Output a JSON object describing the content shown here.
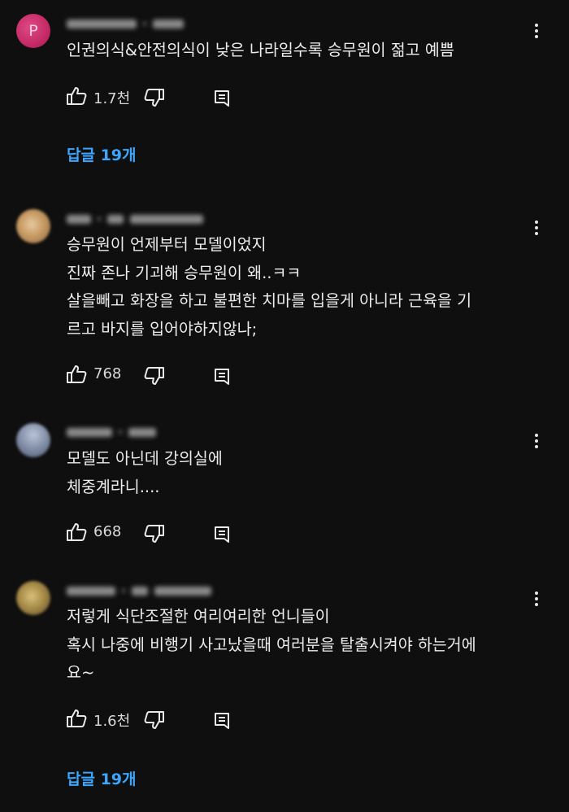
{
  "comments": [
    {
      "avatar_letter": "P",
      "lines": [
        "인권의식&안전의식이 낮은 나라일수록 승무원이 젊고 예쁨"
      ],
      "likes": "1.7천",
      "replies_label": "답글 19개"
    },
    {
      "lines": [
        "승무원이 언제부터 모델이었지",
        "진짜 존나 기괴해 승무원이 왜..ㅋㅋ",
        "살을빼고 화장을 하고 불편한 치마를 입을게 아니라 근육을 기",
        "르고 바지를 입어야하지않나;"
      ],
      "likes": "768"
    },
    {
      "lines": [
        "모델도 아닌데 강의실에",
        "체중계라니...."
      ],
      "likes": "668"
    },
    {
      "lines": [
        "저렇게 식단조절한 여리여리한 언니들이",
        "혹시 나중에 비행기 사고났을때 여러분을 탈출시켜야 하는거에",
        "요~"
      ],
      "likes": "1.6천",
      "replies_label": "답글 19개"
    }
  ],
  "colors": {
    "background": "#0f0f0f",
    "text": "#f1f1f1",
    "reply_link": "#3ea6ff",
    "avatar_p": "#c2185b"
  },
  "icons": {
    "like": "thumb-up-icon",
    "dislike": "thumb-down-icon",
    "reply": "comment-reply-icon",
    "menu": "more-vertical-icon"
  }
}
